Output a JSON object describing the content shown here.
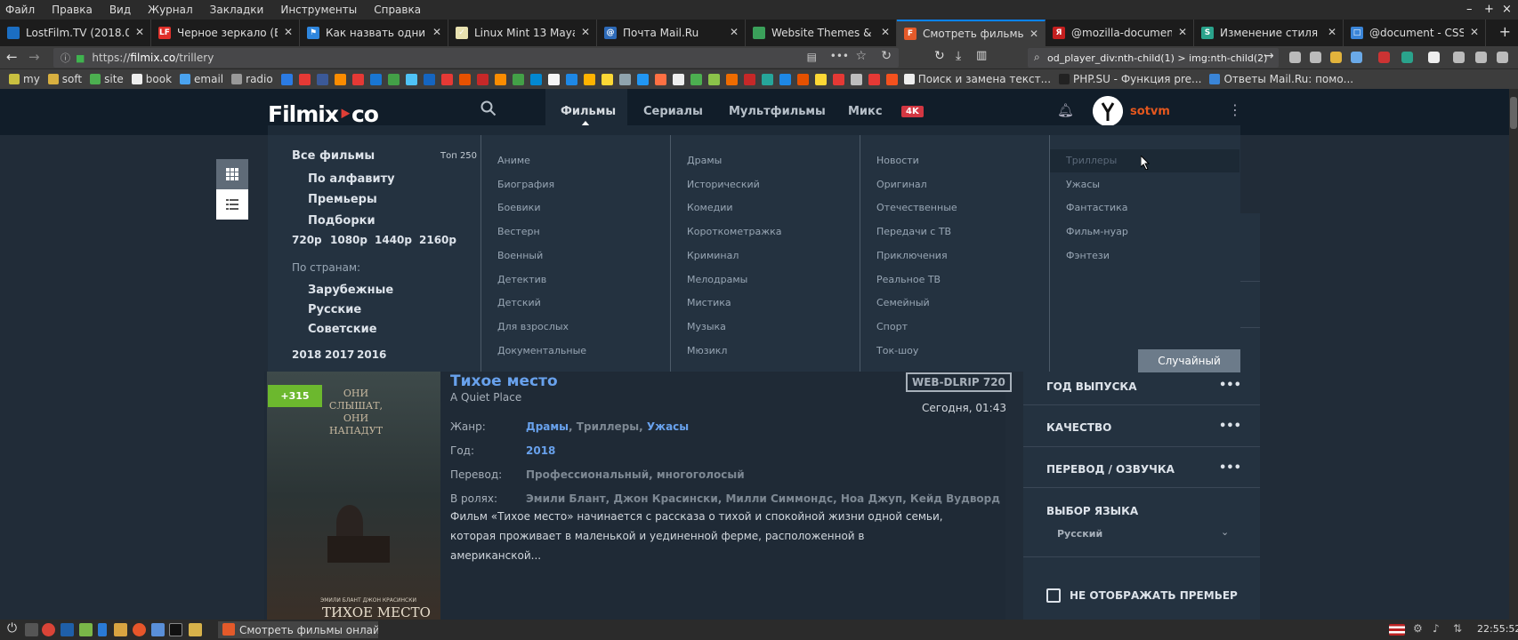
{
  "menubar": {
    "items": [
      "Файл",
      "Правка",
      "Вид",
      "Журнал",
      "Закладки",
      "Инструменты",
      "Справка"
    ]
  },
  "tabs": [
    {
      "title": "LostFilm.TV (2018.02.",
      "color": "#1b6ec2",
      "glyph": ""
    },
    {
      "title": "Черное зеркало (Bla",
      "color": "#e0302a",
      "glyph": "LF"
    },
    {
      "title": "Как назвать одним с",
      "color": "#2e86de",
      "glyph": "⚑"
    },
    {
      "title": "Linux Mint 13 Maya (",
      "color": "#e8e1b0",
      "glyph": "✓"
    },
    {
      "title": "Почта Mail.Ru",
      "color": "#2d6ab8",
      "glyph": "@"
    },
    {
      "title": "Website Themes & Sk",
      "color": "#3aa05a",
      "glyph": ""
    },
    {
      "title": "Смотреть фильмы о",
      "color": "#e45a2a",
      "glyph": "F",
      "active": true
    },
    {
      "title": "@mozilla-document",
      "color": "#c41f1f",
      "glyph": "Я"
    },
    {
      "title": "Изменение стиля \"F",
      "color": "#2aa38c",
      "glyph": "S"
    },
    {
      "title": "@document - CSS: Ca",
      "color": "#3a85d8",
      "glyph": "□"
    }
  ],
  "urlbar": {
    "url_prefix": "https://",
    "host": "filmix.co",
    "path": "/trillery"
  },
  "searchbar": {
    "text": "od_player_div:nth-child(1) > img:nth-child(2)"
  },
  "bookmarks": [
    {
      "label": "my",
      "color": "#c9c040"
    },
    {
      "label": "soft",
      "color": "#d8b040"
    },
    {
      "label": "site",
      "color": "#4caf50"
    },
    {
      "label": "book",
      "color": "#eee"
    },
    {
      "label": "email",
      "color": "#4aa3f0"
    },
    {
      "label": "radio",
      "color": "#999"
    }
  ],
  "bookmark_tail": [
    {
      "label": "Поиск и замена текст...",
      "color": "#eee"
    },
    {
      "label": "PHP.SU - Функция pre...",
      "color": "#222"
    },
    {
      "label": "Ответы Mail.Ru: помо...",
      "color": "#3a85d8"
    }
  ],
  "site": {
    "logo_a": "Filmix",
    "logo_b": "co",
    "nav": [
      "Фильмы",
      "Сериалы",
      "Мультфильмы",
      "Микс"
    ],
    "badge_4k": "4K",
    "username": "sotvm"
  },
  "dropdown": {
    "col0": {
      "all": "Все фильмы",
      "top": "Топ 250",
      "links": [
        "По алфавиту",
        "Премьеры",
        "Подборки"
      ],
      "resolutions": [
        "720p",
        "1080p",
        "1440p",
        "2160p"
      ],
      "countries_label": "По странам:",
      "countries": [
        "Зарубежные",
        "Русские",
        "Советские"
      ],
      "years": [
        "2018",
        "2017",
        "2016"
      ]
    },
    "col1": [
      "Аниме",
      "Биография",
      "Боевики",
      "Вестерн",
      "Военный",
      "Детектив",
      "Детский",
      "Для взрослых",
      "Документальные"
    ],
    "col2": [
      "Драмы",
      "Исторический",
      "Комедии",
      "Короткометражка",
      "Криминал",
      "Мелодрамы",
      "Мистика",
      "Музыка",
      "Мюзикл"
    ],
    "col3": [
      "Новости",
      "Оригинал",
      "Отечественные",
      "Передачи с ТВ",
      "Приключения",
      "Реальное ТВ",
      "Семейный",
      "Спорт",
      "Ток-шоу"
    ],
    "col4": [
      "Триллеры",
      "Ужасы",
      "Фантастика",
      "Фильм-нуар",
      "Фэнтези"
    ],
    "random": "Случайный"
  },
  "movie": {
    "plus": "+315",
    "title": "Тихое место",
    "original": "A Quiet Place",
    "quality": "WEB-DLRIP 720",
    "date": "Сегодня, 01:43",
    "genre_label": "Жанр:",
    "genre_a": "Драмы",
    "genre_sep1": ", ",
    "genre_b": "Триллеры",
    "genre_sep2": ", ",
    "genre_c": "Ужасы",
    "year_label": "Год:",
    "year": "2018",
    "translation_label": "Перевод:",
    "translation": "Профессиональный, многоголосый",
    "cast_label": "В ролях:",
    "cast": "Эмили Блант, Джон Красински, Милли Симмондс, Ноа Джуп, Кейд Вудворд",
    "desc": "Фильм «Тихое место» начинается с рассказа о тихой и спокойной жизни одной семьи, которая проживает в маленькой и уединенной ферме, расположенной в американской...",
    "poster_top": "ОНИ СЛЫШАТ, ОНИ НАПАДУТ",
    "poster_actors": "ЭМИЛИ БЛАНТ   ДЖОН КРАСИНСКИ",
    "poster_title": "ТИХОЕ МЕСТО"
  },
  "sidebar": {
    "year": "ГОД ВЫПУСКА",
    "quality": "КАЧЕСТВО",
    "translation": "ПЕРЕВОД / ОЗВУЧКА",
    "language": "ВЫБОР ЯЗЫКА",
    "language_value": "Русский",
    "hide": "НЕ ОТОБРАЖАТЬ ПРЕМЬЕР",
    "dots": "•••"
  },
  "taskbar": {
    "window_title": "Смотреть фильмы онлай...",
    "clock": "22:55:52"
  }
}
